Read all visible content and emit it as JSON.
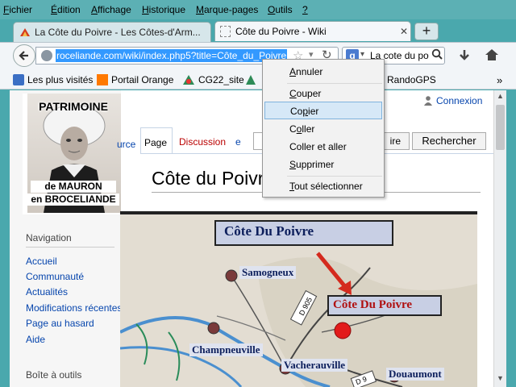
{
  "menubar": {
    "items": [
      {
        "text": "Fichier",
        "key": "F",
        "rest": "ichier"
      },
      {
        "text": "Édition",
        "key": "É",
        "rest": "dition"
      },
      {
        "text": "Affichage",
        "key": "A",
        "rest": "ffichage"
      },
      {
        "text": "Historique",
        "key": "H",
        "rest": "istorique"
      },
      {
        "text": "Marque-pages",
        "key": "M",
        "rest": "arque-pages"
      },
      {
        "text": "Outils",
        "key": "O",
        "rest": "utils"
      },
      {
        "text": "?",
        "key": "?",
        "rest": ""
      }
    ]
  },
  "tabs": [
    {
      "label": "La Côte du Poivre - Les Côtes-d'Arm...",
      "active": false
    },
    {
      "label": "Côte du Poivre - Wiki",
      "active": true
    }
  ],
  "new_tab_label": "+",
  "urlbar": {
    "value": "roceliande.com/wiki/index.php5?title=Côte_du_Poivre"
  },
  "search": {
    "value": "La cote du po"
  },
  "bookmarks": [
    {
      "label": "Les plus visités",
      "icon": "bookmark-star-icon"
    },
    {
      "label": "Portail Orange",
      "icon": "orange-logo-icon"
    },
    {
      "label": "CG22_site",
      "icon": "cg22-logo-icon"
    },
    {
      "label": "RandoGPS",
      "icon": "rando-icon"
    }
  ],
  "bookmarks_overflow": "»",
  "logo": {
    "line1": "PATRIMOINE",
    "line2": "de MAURON",
    "line3": "en BROCELIANDE"
  },
  "login": "Connexion",
  "wiki_tabs": {
    "read_partial": "urce",
    "page": "Page",
    "discussion": "Discussion",
    "extra": "e"
  },
  "search_buttons": {
    "go_partial": "ire",
    "search": "Rechercher"
  },
  "page_title": "Côte du Poivre",
  "sidebar": {
    "nav_heading": "Navigation",
    "nav_items": [
      "Accueil",
      "Communauté",
      "Actualités",
      "Modifications récentes",
      "Page au hasard",
      "Aide"
    ],
    "tools_heading": "Boîte à outils"
  },
  "context_menu": {
    "items": [
      {
        "label": "Annuler",
        "key": "A",
        "rest": "nnuler"
      },
      {
        "label": "Couper",
        "key": "C",
        "rest": "ouper"
      },
      {
        "label": "Copier",
        "key": "p",
        "pre": "Co",
        "rest": "ier"
      },
      {
        "label": "Coller",
        "key": "o",
        "pre": "C",
        "rest": "ller"
      },
      {
        "label": "Coller et aller",
        "key": "",
        "rest": ""
      },
      {
        "label": "Supprimer",
        "key": "S",
        "rest": "upprimer"
      },
      {
        "label": "Tout sélectionner",
        "key": "T",
        "rest": "out sélectionner"
      }
    ],
    "highlighted": "Copier"
  },
  "map": {
    "title": "Côte Du Poivre",
    "labels": [
      "Samogneux",
      "Côte Du Poivre",
      "Champneuville",
      "Vacherauville",
      "Douaumont"
    ],
    "road_labels": [
      "D 905",
      "D 9"
    ]
  },
  "colors": {
    "window_bg": "#4aa8ad",
    "link": "#0645ad",
    "menu_highlight": "#d6e8f7",
    "map_title": "#0d1f5c",
    "arrow": "#d42a1e"
  }
}
